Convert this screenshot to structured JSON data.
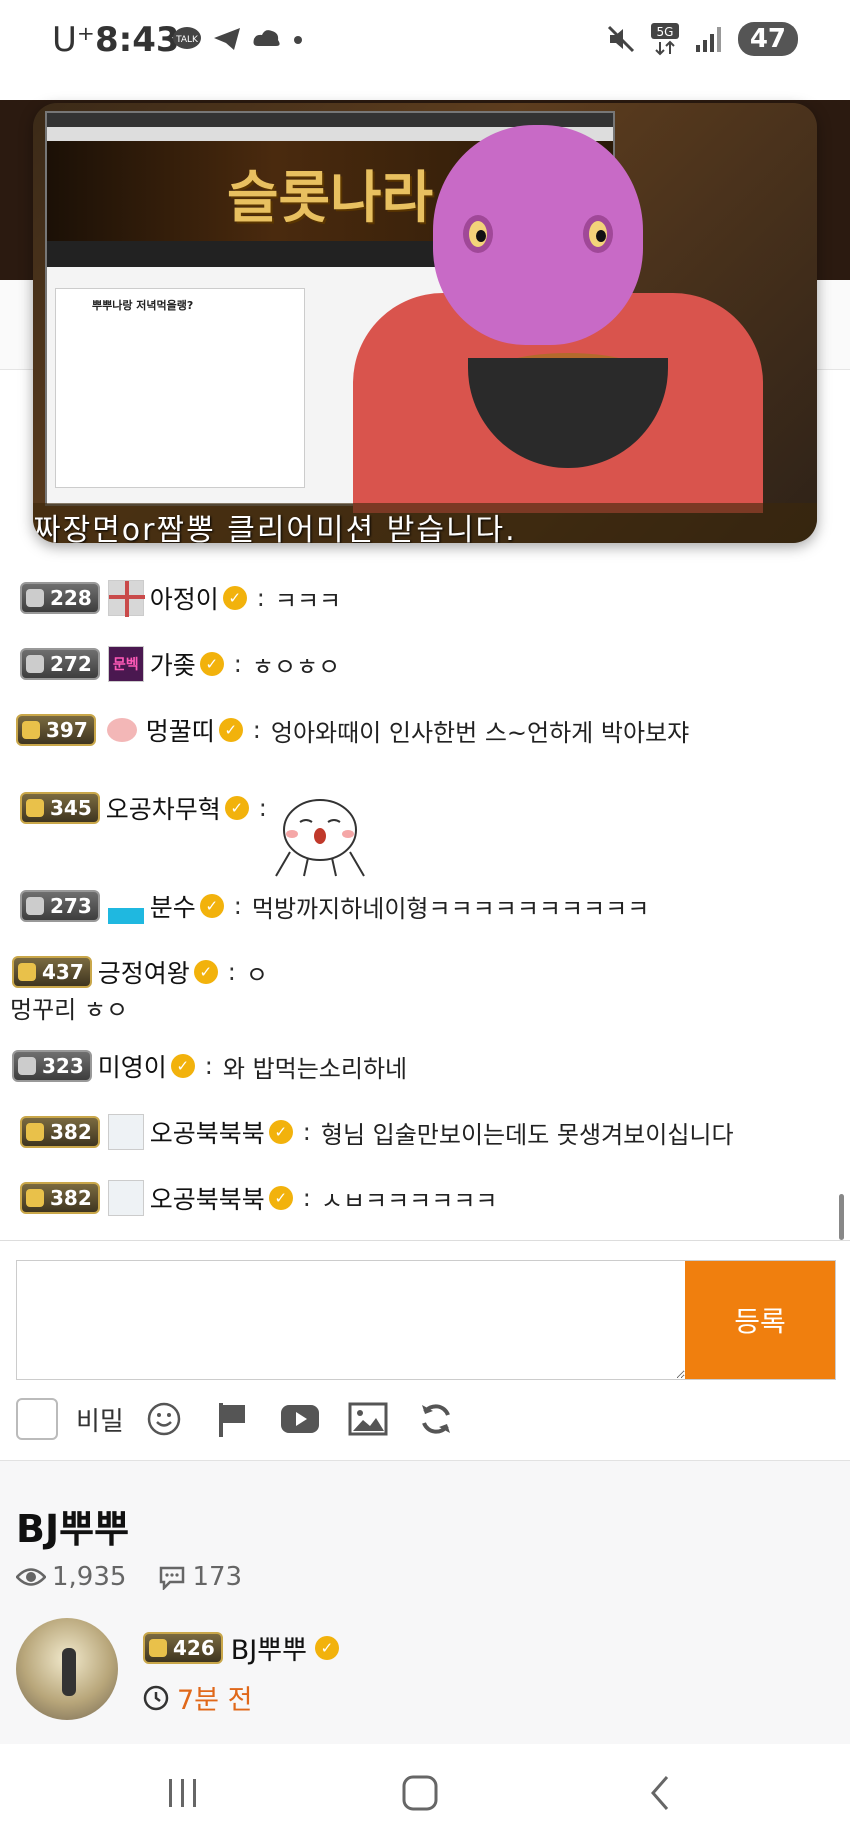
{
  "status_bar": {
    "carrier": "U⁺",
    "time": "8:43",
    "battery": "47",
    "network": "5G"
  },
  "video": {
    "screen_logo": "슬롯나라",
    "screen_post_title": "뿌뿌나랑 저녁먹을랭?",
    "caption": "짜장면or짬뽕 클리어미션 받습니다."
  },
  "chat": {
    "messages": [
      {
        "level": "228",
        "nick": "아정이",
        "text": "ㅋㅋㅋ",
        "badge": "silver",
        "avatar_color": "#c94a4a"
      },
      {
        "level": "272",
        "nick": "가좆",
        "text": "ㅎㅇㅎㅇ",
        "badge": "silver",
        "avatar_color": "#4a1850",
        "avatar_text": "문벡"
      },
      {
        "level": "397",
        "nick": "멍꿀띠",
        "text": "엉아와때이 인사한번 스~언하게 박아보쟈",
        "badge": "gold",
        "avatar_color": "#f3b7b7"
      },
      {
        "level": "345",
        "nick": "오공차무혁",
        "text": "",
        "badge": "gold",
        "avatar_color": ""
      },
      {
        "level": "273",
        "nick": "분수",
        "text": "먹방까지하네이형ㅋㅋㅋㅋㅋㅋㅋㅋㅋㅋ",
        "badge": "silver",
        "avatar_color": "#1fb8e0"
      },
      {
        "level": "437",
        "nick": "긍정여왕",
        "text": "ㅇ",
        "badge": "gold",
        "avatar_color": ""
      },
      {
        "level": "323",
        "nick": "미영이",
        "text": "와 밥먹는소리하네",
        "badge": "silver",
        "avatar_color": ""
      },
      {
        "level": "382",
        "nick": "오공북북북",
        "text": "형님 입술만보이는데도 못생겨보이십니다",
        "badge": "gold",
        "avatar_color": "#eef2f5"
      },
      {
        "level": "382",
        "nick": "오공북북북",
        "text": "ㅅㅂㅋㅋㅋㅋㅋㅋ",
        "badge": "gold",
        "avatar_color": "#eef2f5"
      }
    ],
    "wrapped_line": "멍꾸리 ㅎㅇ"
  },
  "input": {
    "placeholder": "",
    "submit_label": "등록",
    "secret_label": "비밀"
  },
  "post": {
    "title": "BJ뿌뿌",
    "views": "1,935",
    "comments": "173",
    "author_level": "426",
    "author_name": "BJ뿌뿌",
    "time_ago": "7분 전"
  },
  "colors": {
    "accent": "#f07f0e",
    "time": "#e0681a",
    "verified": "#f2b20c"
  }
}
